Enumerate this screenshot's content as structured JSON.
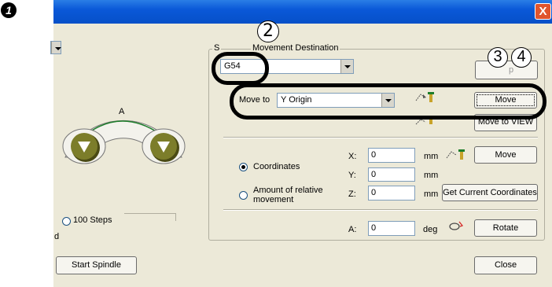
{
  "step_marker": "❶",
  "window": {
    "close_glyph": "X"
  },
  "group": {
    "title": "Movement Destination",
    "title_prefix": "S"
  },
  "coord_system": {
    "selected": "G54"
  },
  "move_to": {
    "label": "Move to",
    "selected": "Y Origin",
    "button": "Move"
  },
  "view_button": "Move to VIEW",
  "partial_button": "p",
  "mode": {
    "coordinates_label": "Coordinates",
    "relative_label": "Amount of relative movement",
    "relative_line1": "Amount of relative",
    "relative_line2": "movement",
    "selected": "Coordinates"
  },
  "axes": {
    "x": {
      "label": "X:",
      "value": "0",
      "unit": "mm"
    },
    "y": {
      "label": "Y:",
      "value": "0",
      "unit": "mm"
    },
    "z": {
      "label": "Z:",
      "value": "0",
      "unit": "mm"
    },
    "a": {
      "label": "A:",
      "value": "0",
      "unit": "deg"
    }
  },
  "buttons": {
    "move_xyz": "Move",
    "get_current": "Get Current Coordinates",
    "rotate": "Rotate",
    "start_spindle": "Start Spindle",
    "close": "Close"
  },
  "jog": {
    "axis_label": "A",
    "step_option": "100 Steps",
    "cut_text": "d"
  },
  "callouts": {
    "n2": "2",
    "n3": "3",
    "n4": "4"
  }
}
